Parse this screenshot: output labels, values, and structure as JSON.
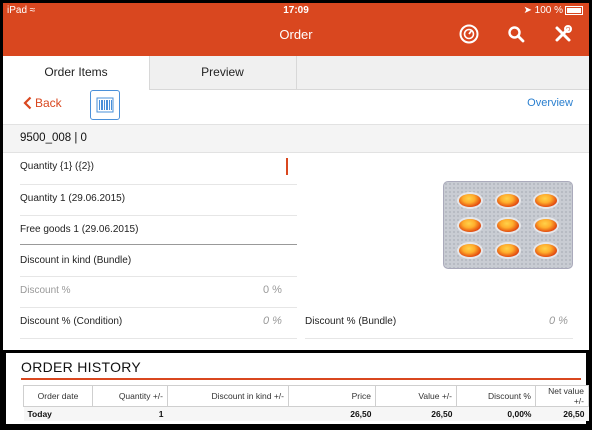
{
  "status": {
    "carrier": "iPad",
    "time": "17:09",
    "battery": "100 %"
  },
  "header": {
    "title": "Order",
    "icons": [
      "dashboard-icon",
      "search-icon",
      "tools-icon"
    ],
    "accent": "#d9471f"
  },
  "tabs": [
    {
      "label": "Order Items",
      "active": true
    },
    {
      "label": "Preview",
      "active": false
    }
  ],
  "toolbar": {
    "back_label": "Back",
    "overview_label": "Overview"
  },
  "item": {
    "title": "9500_008 | 0",
    "rows": {
      "quantity": "Quantity {1} ({2})",
      "quantity1": "Quantity 1 (29.06.2015)",
      "free_goods": "Free goods 1 (29.06.2015)",
      "discount_kind": "Discount in kind (Bundle)",
      "discount_pct": "Discount %",
      "discount_pct_value": "0 %",
      "discount_condition": "Discount % (Condition)",
      "discount_condition_value": "0 %",
      "discount_bundle": "Discount % (Bundle)",
      "discount_bundle_value": "0 %"
    }
  },
  "history": {
    "title": "ORDER HISTORY",
    "columns": [
      "Order date",
      "Quantity +/-",
      "Discount in kind +/-",
      "Price",
      "Value +/-",
      "Discount %",
      "Net value +/-"
    ],
    "rows": [
      [
        "Today",
        "1",
        "",
        "26,50",
        "26,50",
        "0,00%",
        "26,50"
      ]
    ]
  }
}
